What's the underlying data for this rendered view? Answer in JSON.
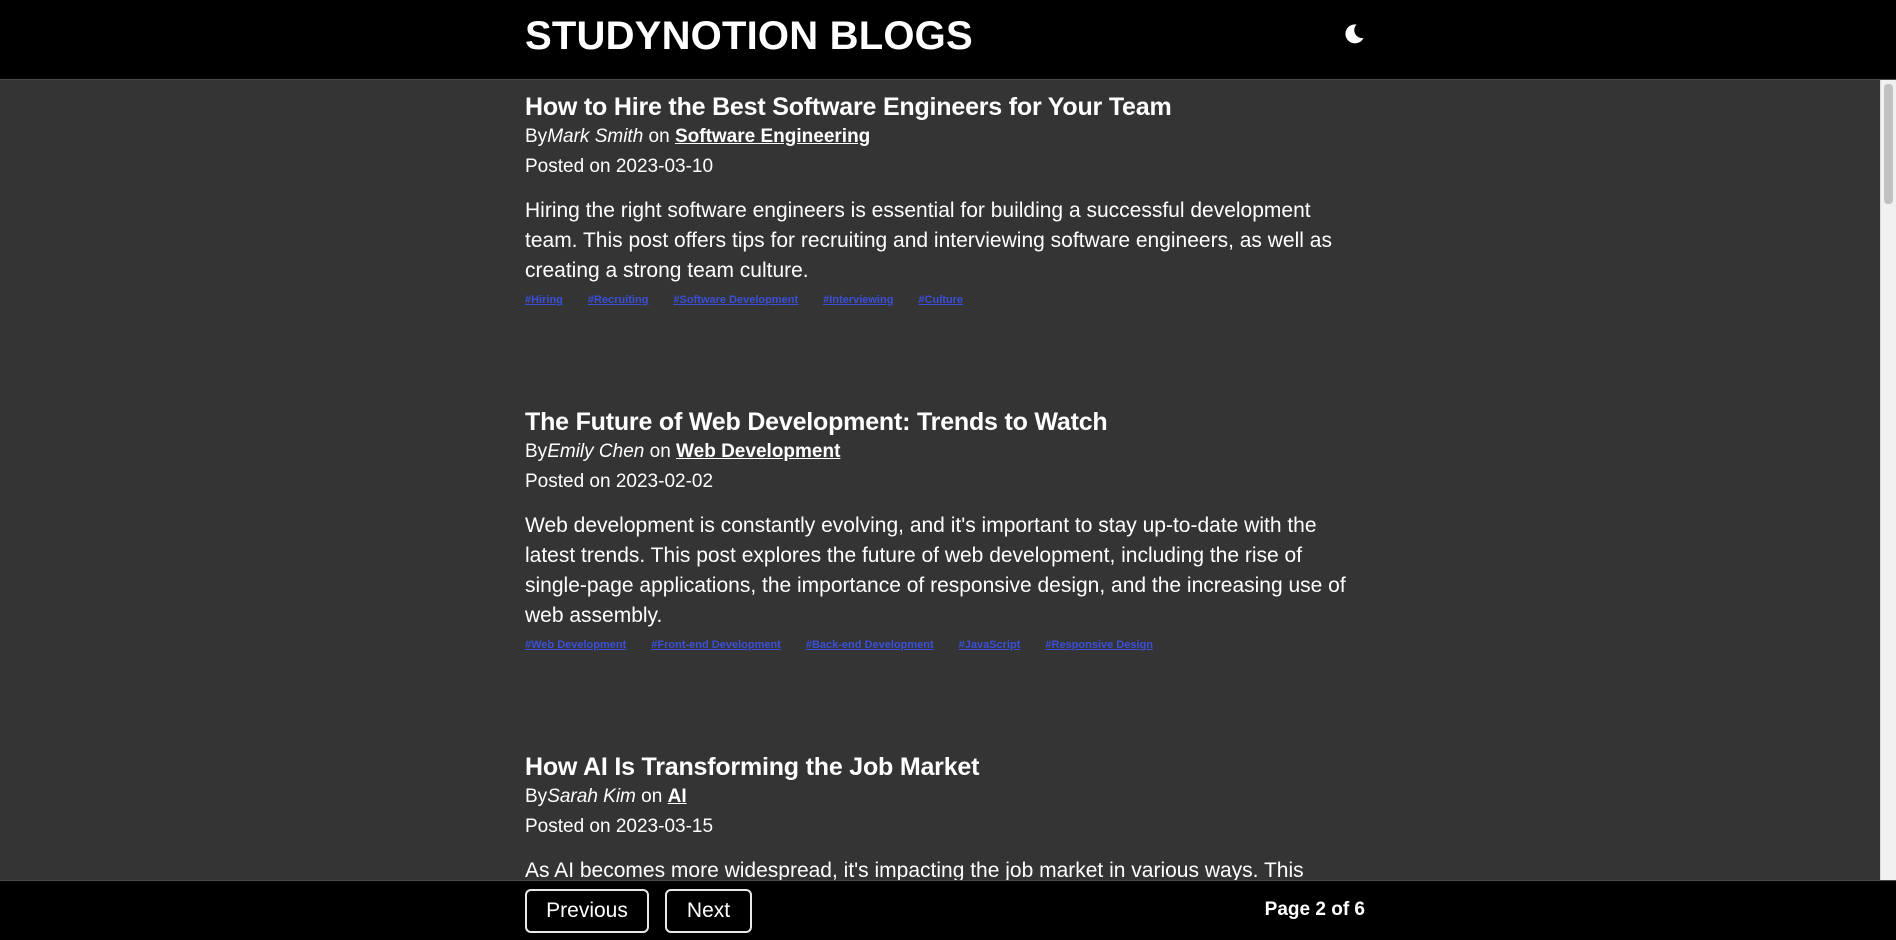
{
  "header": {
    "title": "STUDYNOTION BLOGS",
    "theme_icon": "moon-icon"
  },
  "posts": [
    {
      "title": "How to Hire the Best Software Engineers for Your Team",
      "by_prefix": "By",
      "author": "Mark Smith",
      "on": " on ",
      "category": "Software Engineering",
      "date_label": "Posted on 2023-03-10",
      "content": "Hiring the right software engineers is essential for building a successful development team. This post offers tips for recruiting and interviewing software engineers, as well as creating a strong team culture.",
      "tags": [
        "#Hiring",
        "#Recruiting",
        "#Software Development",
        "#Interviewing",
        "#Culture"
      ]
    },
    {
      "title": "The Future of Web Development: Trends to Watch",
      "by_prefix": "By",
      "author": "Emily Chen",
      "on": " on ",
      "category": "Web Development",
      "date_label": "Posted on 2023-02-02",
      "content": "Web development is constantly evolving, and it's important to stay up-to-date with the latest trends. This post explores the future of web development, including the rise of single-page applications, the importance of responsive design, and the increasing use of web assembly.",
      "tags": [
        "#Web Development",
        "#Front-end Development",
        "#Back-end Development",
        "#JavaScript",
        "#Responsive Design"
      ]
    },
    {
      "title": "How AI Is Transforming the Job Market",
      "by_prefix": "By",
      "author": "Sarah Kim",
      "on": " on ",
      "category": "AI",
      "date_label": "Posted on 2023-03-15",
      "content": "As AI becomes more widespread, it's impacting the job market in various ways. This"
    }
  ],
  "footer": {
    "previous_label": "Previous",
    "next_label": "Next",
    "page_info": "Page 2 of 6"
  },
  "colors": {
    "background": "#343434",
    "bar": "#000000",
    "tag": "#3b4fd8"
  }
}
